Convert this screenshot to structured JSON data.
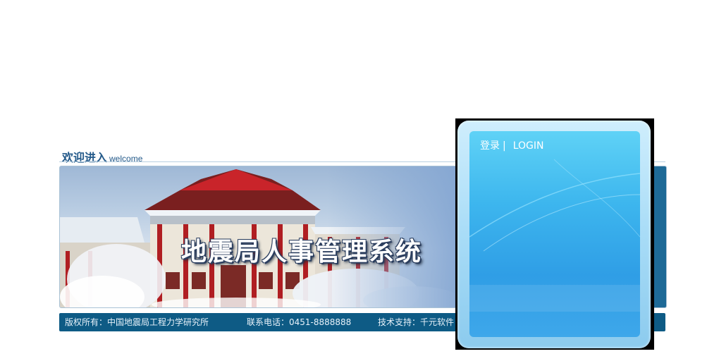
{
  "welcome": {
    "title_cn": "欢迎进入",
    "title_en": "welcome"
  },
  "banner": {
    "system_title": "地震局人事管理系统"
  },
  "footer": {
    "copyright": "版权所有：中国地震局工程力学研究所",
    "phone": "联系电话：0451-8888888",
    "support": "技术支持：千元软件"
  },
  "login": {
    "label_cn": "登录",
    "separator": "|",
    "label_en": "LOGIN"
  },
  "colors": {
    "brand_blue": "#0e5b85",
    "panel_blue": "#3db6ee",
    "title_blue": "#245a8a"
  }
}
